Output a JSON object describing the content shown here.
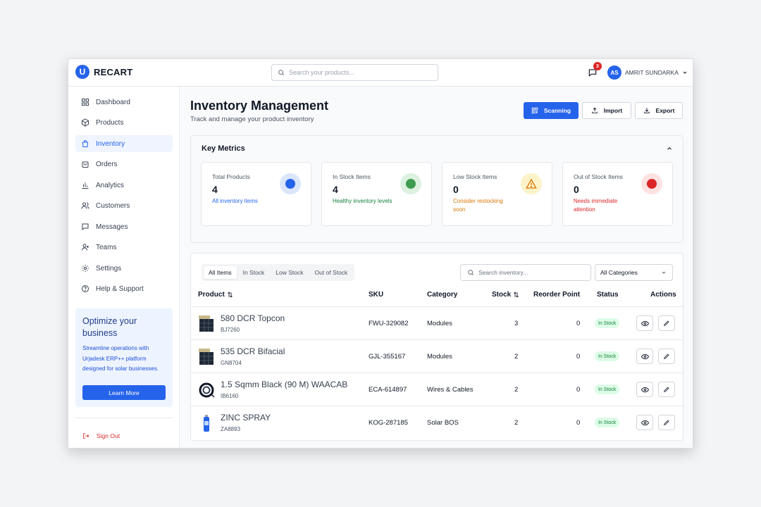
{
  "app": {
    "logo_letter": "U",
    "name": "RECART"
  },
  "topbar": {
    "search_placeholder": "Search your products...",
    "notifications_count": "3",
    "user_initials": "AS",
    "user_name": "AMRIT SUNDARKA"
  },
  "sidebar": {
    "items": [
      {
        "label": "Dashboard",
        "icon": "dashboard-icon"
      },
      {
        "label": "Products",
        "icon": "box-icon"
      },
      {
        "label": "Inventory",
        "icon": "bag-icon",
        "active": true
      },
      {
        "label": "Orders",
        "icon": "shopping-bag-icon"
      },
      {
        "label": "Analytics",
        "icon": "bar-chart-icon"
      },
      {
        "label": "Customers",
        "icon": "users-icon"
      },
      {
        "label": "Messages",
        "icon": "message-icon"
      },
      {
        "label": "Teams",
        "icon": "team-icon"
      },
      {
        "label": "Settings",
        "icon": "gear-icon"
      },
      {
        "label": "Help & Support",
        "icon": "help-icon"
      }
    ],
    "promo": {
      "title": "Optimize your business",
      "text": "Streamline operations with Urjadesk ERP++ platform designed for solar businesses.",
      "button": "Learn More"
    },
    "sign_out": "Sign Out"
  },
  "header": {
    "title": "Inventory Management",
    "subtitle": "Track and manage your product inventory",
    "scan_label": "Scanning",
    "import_label": "Import",
    "export_label": "Export"
  },
  "metrics": {
    "title": "Key Metrics",
    "cards": [
      {
        "label": "Total Products",
        "value": "4",
        "note": "All inventory items",
        "note_color": "#2563eb",
        "dot_color": "#2563eb",
        "ring_color": "#dbe6fb"
      },
      {
        "label": "In Stock Items",
        "value": "4",
        "note": "Healthy inventory levels",
        "note_color": "#15803d",
        "dot_color": "#3f9b50",
        "ring_color": "#dcf1e0"
      },
      {
        "label": "Low Stock Items",
        "value": "0",
        "note": "Consider restocking soon",
        "note_color": "#d97706",
        "dot_color": "#d97706",
        "ring_color": "#fdf3c8"
      },
      {
        "label": "Out of Stock Items",
        "value": "0",
        "note": "Needs immediate attention",
        "note_color": "#dc2626",
        "dot_color": "#dc2626",
        "ring_color": "#fde2e2"
      }
    ]
  },
  "inventory": {
    "tabs": [
      "All Items",
      "In Stock",
      "Low Stock",
      "Out of Stock"
    ],
    "search_placeholder": "Search inventory...",
    "category_selected": "All Categories",
    "columns": {
      "product": "Product",
      "sku": "SKU",
      "category": "Category",
      "stock": "Stock",
      "reorder": "Reorder Point",
      "status": "Status",
      "actions": "Actions"
    },
    "rows": [
      {
        "name": "580 DCR Topcon",
        "code": "BJ7260",
        "sku": "FWU-329082",
        "category": "Modules",
        "stock": "3",
        "reorder": "0",
        "status": "In Stock",
        "thumb": "panel"
      },
      {
        "name": "535 DCR Bifacial",
        "code": "GN8704",
        "sku": "GJL-355167",
        "category": "Modules",
        "stock": "2",
        "reorder": "0",
        "status": "In Stock",
        "thumb": "panel"
      },
      {
        "name": "1.5 Sqmm Black (90 M) WAACAB",
        "code": "IB6160",
        "sku": "ECA-614897",
        "category": "Wires & Cables",
        "stock": "2",
        "reorder": "0",
        "status": "In Stock",
        "thumb": "cable"
      },
      {
        "name": "ZINC SPRAY",
        "code": "ZA8893",
        "sku": "KOG-287185",
        "category": "Solar BOS",
        "stock": "2",
        "reorder": "0",
        "status": "In Stock",
        "thumb": "spray"
      }
    ]
  }
}
